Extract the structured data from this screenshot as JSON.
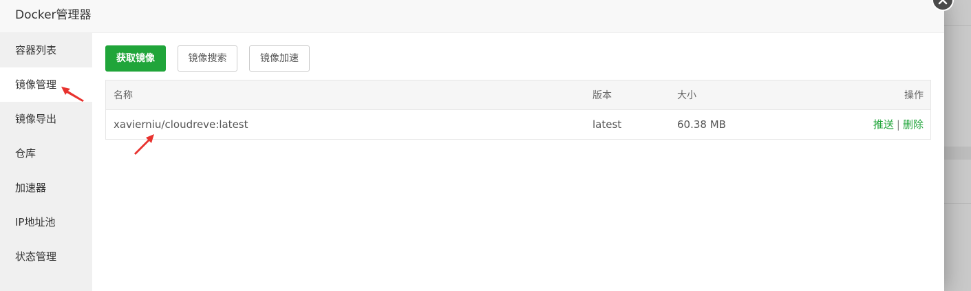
{
  "dialog": {
    "title": "Docker管理器"
  },
  "sidebar": {
    "items": [
      {
        "label": "容器列表"
      },
      {
        "label": "镜像管理"
      },
      {
        "label": "镜像导出"
      },
      {
        "label": "仓库"
      },
      {
        "label": "加速器"
      },
      {
        "label": "IP地址池"
      },
      {
        "label": "状态管理"
      }
    ],
    "active_index": 1
  },
  "toolbar": {
    "get_image": "获取镜像",
    "search_image": "镜像搜索",
    "accelerate_image": "镜像加速"
  },
  "table": {
    "headers": {
      "name": "名称",
      "version": "版本",
      "size": "大小",
      "actions": "操作"
    },
    "rows": [
      {
        "name": "xavierniu/cloudreve:latest",
        "version": "latest",
        "size": "60.38 MB",
        "push": "推送",
        "separator": "|",
        "delete": "删除"
      }
    ]
  },
  "colors": {
    "accent": "#20a53a",
    "annotation_arrow": "#e8322e"
  },
  "icons": {
    "close": "close-icon",
    "annotation": "red-arrow-icon"
  }
}
